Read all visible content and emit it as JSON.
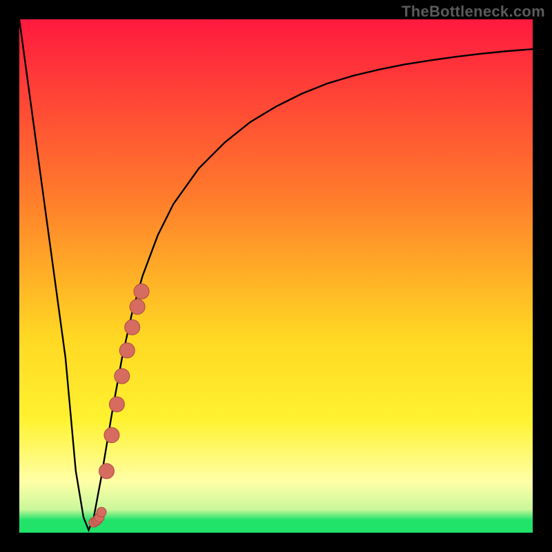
{
  "watermark": "TheBottleneck.com",
  "colors": {
    "frame": "#000000",
    "watermark_text": "#5b5b5b",
    "curve": "#000000",
    "dot_fill": "#d66b60",
    "dot_stroke": "#aa4c43",
    "green_band": "#21e36a",
    "gradient_top": "#ff193f",
    "gradient_mid1": "#ff7d2b",
    "gradient_mid2": "#ffd823",
    "gradient_low": "#fff230",
    "gradient_bottom": "#ffffa6"
  },
  "chart_data": {
    "type": "line",
    "title": "",
    "xlabel": "",
    "ylabel": "",
    "xlim": [
      0,
      100
    ],
    "ylim": [
      0,
      100
    ],
    "series": [
      {
        "name": "bottleneck-curve",
        "x": [
          0,
          3,
          6,
          9,
          11,
          12.5,
          13.5,
          14.5,
          16,
          18,
          20,
          22,
          24,
          27,
          30,
          35,
          40,
          45,
          50,
          55,
          60,
          65,
          70,
          75,
          80,
          85,
          90,
          95,
          100
        ],
        "y": [
          100,
          78,
          56,
          34,
          12,
          3,
          0.5,
          3,
          11,
          23,
          34,
          43,
          50,
          58,
          64,
          71,
          76,
          80,
          83,
          85.5,
          87.5,
          89,
          90.2,
          91.2,
          92,
          92.7,
          93.3,
          93.8,
          94.2
        ]
      }
    ],
    "highlight_points": {
      "name": "highlighted-dots",
      "x": [
        14.5,
        15.0,
        15.3,
        15.6,
        16.0,
        17.0,
        18.0,
        19.0,
        20.0,
        21.0,
        22.0,
        23.0,
        23.8
      ],
      "y": [
        2.0,
        2.3,
        2.6,
        3.0,
        4.0,
        12.0,
        19.0,
        25.0,
        30.5,
        35.5,
        40.0,
        44.0,
        47.0
      ]
    }
  }
}
